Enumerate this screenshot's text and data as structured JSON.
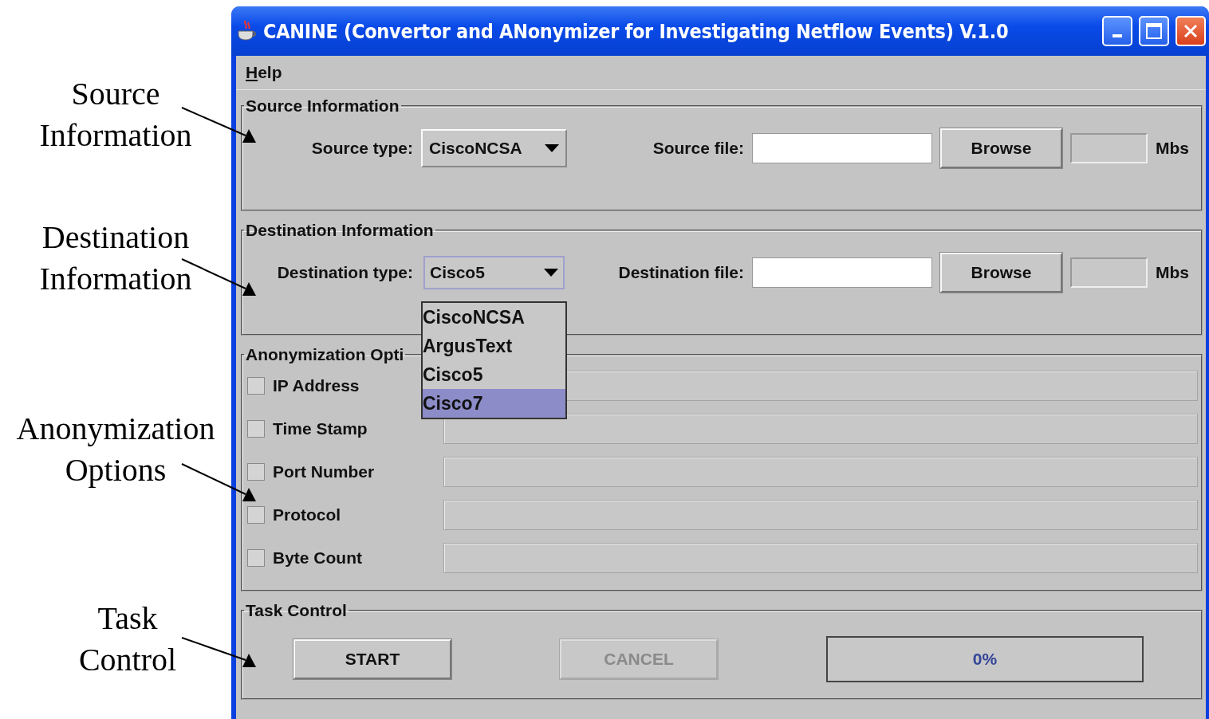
{
  "annotations": [
    {
      "text": "Source Information"
    },
    {
      "text": "Destination Information"
    },
    {
      "text": "Anonymization Options"
    },
    {
      "text": "Task Control"
    }
  ],
  "window": {
    "title": "CANINE (Convertor and ANonymizer for Investigating Netflow Events) V.1.0"
  },
  "menu": [
    "Help"
  ],
  "source": {
    "legend": "Source Information",
    "type_label": "Source type:",
    "type_value": "CiscoNCSA",
    "focused": false,
    "file_label": "Source file:",
    "browse": "Browse",
    "unit": "Mbs"
  },
  "destination": {
    "legend": "Destination Information",
    "type_label": "Destination type:",
    "type_value": "Cisco5",
    "focused": true,
    "file_label": "Destination file:",
    "browse": "Browse",
    "unit": "Mbs",
    "dropdown": {
      "expanded": true,
      "options": [
        {
          "label": "CiscoNCSA",
          "selected": false
        },
        {
          "label": "ArgusText",
          "selected": false
        },
        {
          "label": "Cisco5",
          "selected": false
        },
        {
          "label": "Cisco7",
          "selected": true
        }
      ]
    }
  },
  "anonymization": {
    "legend": "Anonymization Opti",
    "options": [
      {
        "label": "IP Address",
        "checked": false
      },
      {
        "label": "Time Stamp",
        "checked": false
      },
      {
        "label": "Port Number",
        "checked": false
      },
      {
        "label": "Protocol",
        "checked": false
      },
      {
        "label": "Byte Count",
        "checked": false
      }
    ]
  },
  "task": {
    "legend": "Task Control",
    "start": {
      "label": "START",
      "disabled": false
    },
    "cancel": {
      "label": "CANCEL",
      "disabled": true
    },
    "progress": {
      "reading": "0%"
    }
  }
}
